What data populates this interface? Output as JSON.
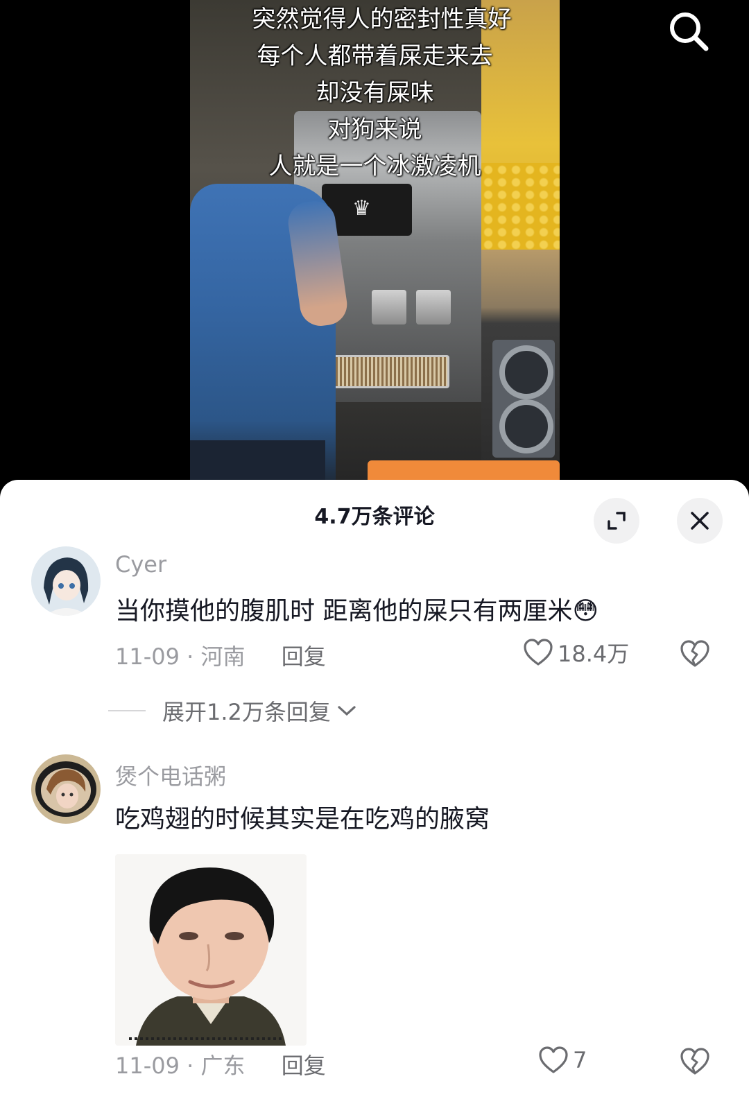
{
  "video": {
    "overlay_lines": [
      "突然觉得人的密封性真好",
      "每个人都带着屎走来去",
      "却没有屎味",
      "对狗来说",
      "人就是一个冰激凌机"
    ],
    "search_icon": "search-icon"
  },
  "sheet": {
    "title": "4.7万条评论",
    "expand_icon": "expand-icon",
    "close_icon": "close-icon"
  },
  "comments": [
    {
      "username": "Cyer",
      "text": "当你摸他的腹肌时 距离他的屎只有两厘米",
      "emoji": "😳",
      "date": "11-09",
      "location": "河南",
      "reply_label": "回复",
      "likes": "18.4万",
      "expand_replies": "展开1.2万条回复"
    },
    {
      "username": "煲个电话粥",
      "text": "吃鸡翅的时候其实是在吃鸡的腋窝",
      "date": "11-09",
      "location": "广东",
      "reply_label": "回复",
      "likes": "7"
    }
  ],
  "separator": " · ",
  "colors": {
    "accent_orange": "#f08a3a",
    "uniform_blue": "#3f73b5",
    "sheet_bg": "#ffffff",
    "secondary_text": "#9a9ba0"
  }
}
